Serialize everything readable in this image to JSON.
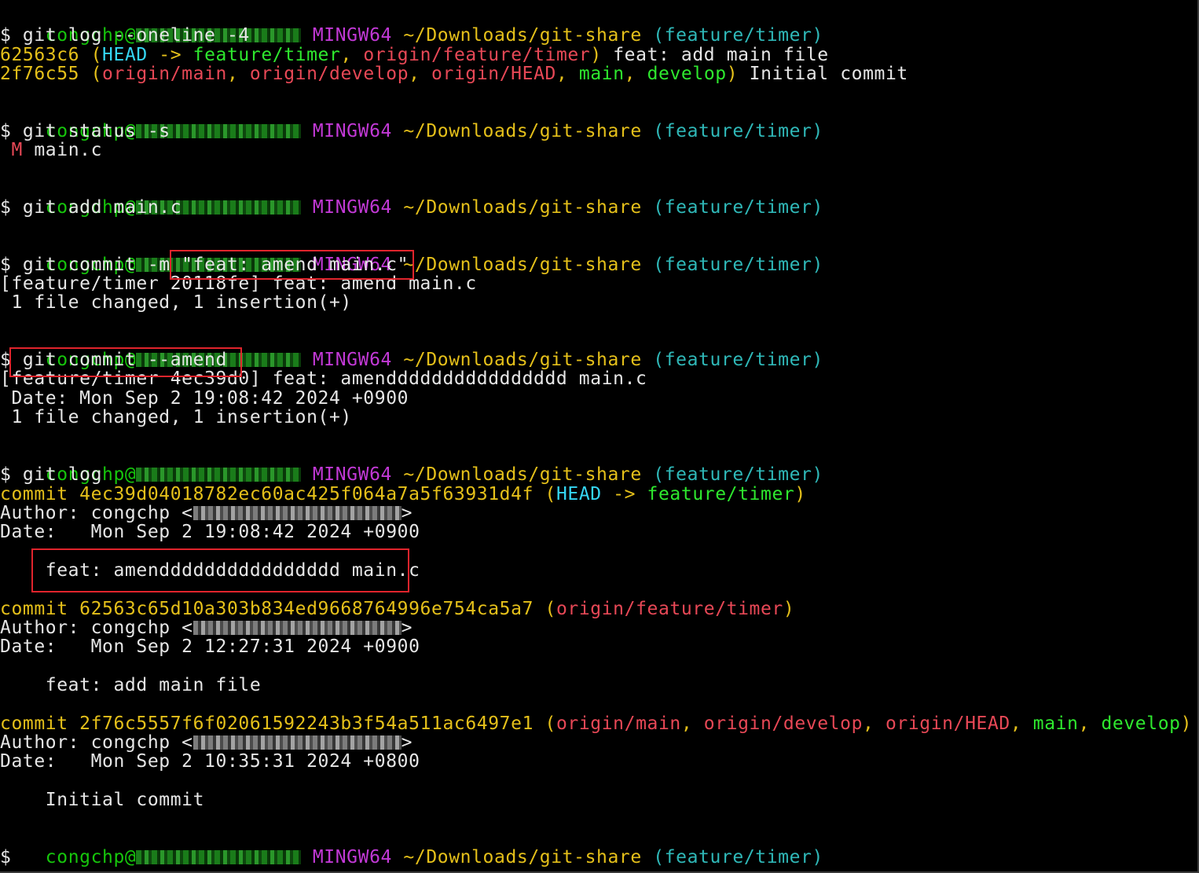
{
  "prompt": {
    "user": "congchp@",
    "shell": "MINGW64",
    "path": "~/Downloads/git-share",
    "branch": "(feature/timer)",
    "dollar": "$"
  },
  "blocks": {
    "log_oneline": {
      "command": " git log --oneline -4",
      "row1": {
        "hash": "62563c6",
        "open": " (",
        "head": "HEAD",
        "arrow": " -> ",
        "branch": "feature/timer",
        "sep": ", ",
        "remote": "origin/feature/timer",
        "close": ")",
        "msg": " feat: add main file"
      },
      "row2": {
        "hash": "2f76c55",
        "open": " (",
        "r1": "origin/main",
        "r2": "origin/develop",
        "r3": "origin/HEAD",
        "l1": "main",
        "l2": "develop",
        "sep": ", ",
        "close": ")",
        "msg": " Initial commit"
      }
    },
    "status": {
      "command": " git status -s",
      "flag": " M",
      "file": " main.c"
    },
    "add": {
      "command": " git add main.c"
    },
    "commit": {
      "command_prefix": " git commit -m ",
      "command_msg": "\"feat: amend main.c\"",
      "out1": "[feature/timer 20118fe] feat: amend main.c",
      "out2": " 1 file changed, 1 insertion(+)"
    },
    "amend": {
      "command": " git commit --amend",
      "out1": "[feature/timer 4ec39d0] feat: amendddddddddddddddd main.c",
      "out2": " Date: Mon Sep 2 19:08:42 2024 +0900",
      "out3": " 1 file changed, 1 insertion(+)"
    },
    "log": {
      "command": " git log",
      "commits": [
        {
          "line": "commit 4ec39d04018782ec60ac425f064a7a5f63931d4f",
          "open": " (",
          "head": "HEAD",
          "arrow": " -> ",
          "branch": "feature/timer",
          "close": ")",
          "author": "Author: congchp <",
          "author_end": ">",
          "date": "Date:   Mon Sep 2 19:08:42 2024 +0900",
          "message": "    feat: amendddddddddddddddd main.c"
        },
        {
          "line": "commit 62563c65d10a303b834ed9668764996e754ca5a7",
          "open": " (",
          "remote": "origin/feature/timer",
          "close": ")",
          "author": "Author: congchp <",
          "author_end": ">",
          "date": "Date:   Mon Sep 2 12:27:31 2024 +0900",
          "message": "    feat: add main file"
        },
        {
          "line": "commit 2f76c5557f6f02061592243b3f54a511ac6497e1",
          "open": " (",
          "r1": "origin/main",
          "r2": "origin/develop",
          "r3": "origin/HEAD",
          "l1": "main",
          "l2": "develop",
          "sep": ", ",
          "close": ")",
          "author": "Author: congchp <",
          "author_end": ">",
          "date": "Date:   Mon Sep 2 10:35:31 2024 +0800",
          "message": "    Initial commit"
        }
      ]
    }
  },
  "colors": {
    "background": "#000000",
    "prompt_user": "#16c60c",
    "prompt_shell": "#c239d6",
    "prompt_path": "#e5c01a",
    "prompt_branch": "#2fb8b8",
    "head_ref": "#35d7f5",
    "remote_ref": "#e74856",
    "local_ref": "#2ee82e",
    "highlight_box": "#e0242c"
  }
}
